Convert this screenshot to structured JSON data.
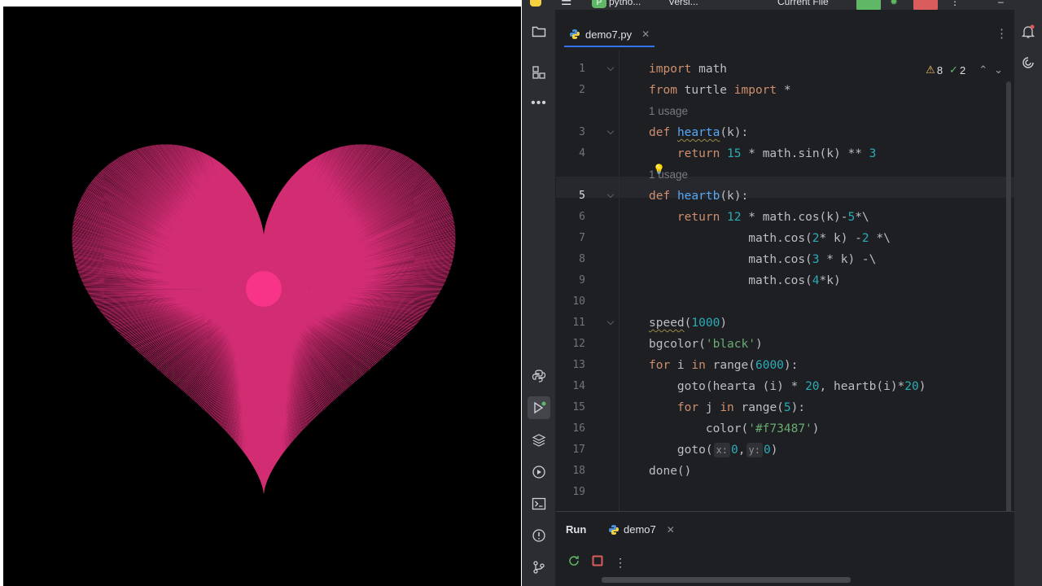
{
  "titlebar": {
    "project_badge": "P",
    "project_name": "pytho...",
    "vcs_label": "Versi...",
    "run_config": "Current File"
  },
  "editor": {
    "tab_label": "demo7.py",
    "inspection": {
      "warnings": "8",
      "weak_warnings": "2"
    },
    "current_line": 5,
    "lines": [
      {
        "n": "1",
        "html": "<span class='kw'>import</span> math"
      },
      {
        "n": "2",
        "html": "<span class='kw'>from</span> turtle <span class='kw'>import</span> *"
      },
      {
        "inlay": "1 usage"
      },
      {
        "n": "3",
        "html": "<span class='kw'>def</span> <span class='fn squig'>hearta</span>(k):"
      },
      {
        "n": "4",
        "html": "    <span class='kw'>return</span> <span class='num'>15</span> * math.sin(k) ** <span class='num'>3</span>"
      },
      {
        "inlay": "1 usage",
        "bulb": true
      },
      {
        "n": "5",
        "html": "<span class='kw'>def</span> <span class='fn'>heartb</span>(k):"
      },
      {
        "n": "6",
        "html": "    <span class='kw'>return</span> <span class='num'>12</span> * math.cos(k)-<span class='num'>5</span>*\\"
      },
      {
        "n": "7",
        "html": "              math.cos(<span class='num'>2</span>* k) -<span class='num'>2</span> *\\"
      },
      {
        "n": "8",
        "html": "              math.cos(<span class='num'>3</span> * k) -\\"
      },
      {
        "n": "9",
        "html": "              math.cos(<span class='num'>4</span>*k)"
      },
      {
        "n": "10",
        "html": ""
      },
      {
        "n": "11",
        "html": "<span class='squig'>speed</span>(<span class='num'>1000</span>)"
      },
      {
        "n": "12",
        "html": "bgcolor(<span class='str'>'black'</span>)"
      },
      {
        "n": "13",
        "html": "<span class='kw'>for</span> i <span class='kw'>in</span> range(<span class='num'>6000</span>):"
      },
      {
        "n": "14",
        "html": "    goto(hearta (i) * <span class='num'>20</span>, heartb(i)*<span class='num'>20</span>)"
      },
      {
        "n": "15",
        "html": "    <span class='kw'>for</span> j <span class='kw'>in</span> range(<span class='num'>5</span>):"
      },
      {
        "n": "16",
        "html": "        color(<span class='str'>'#f73487'</span>)"
      },
      {
        "n": "17",
        "html": "    goto(<span class='hint'>x:</span><span class='num'>0</span>,<span class='hint'>y:</span><span class='num'>0</span>)"
      },
      {
        "n": "18",
        "html": "done()"
      },
      {
        "n": "19",
        "html": ""
      }
    ]
  },
  "run_panel": {
    "title": "Run",
    "tab_label": "demo7"
  },
  "canvas": {
    "background": "#000000",
    "pen_color": "#f73487"
  },
  "colors": {
    "accent": "#3574f0",
    "run_green": "#5fb865",
    "stop_red": "#db5c5c"
  }
}
